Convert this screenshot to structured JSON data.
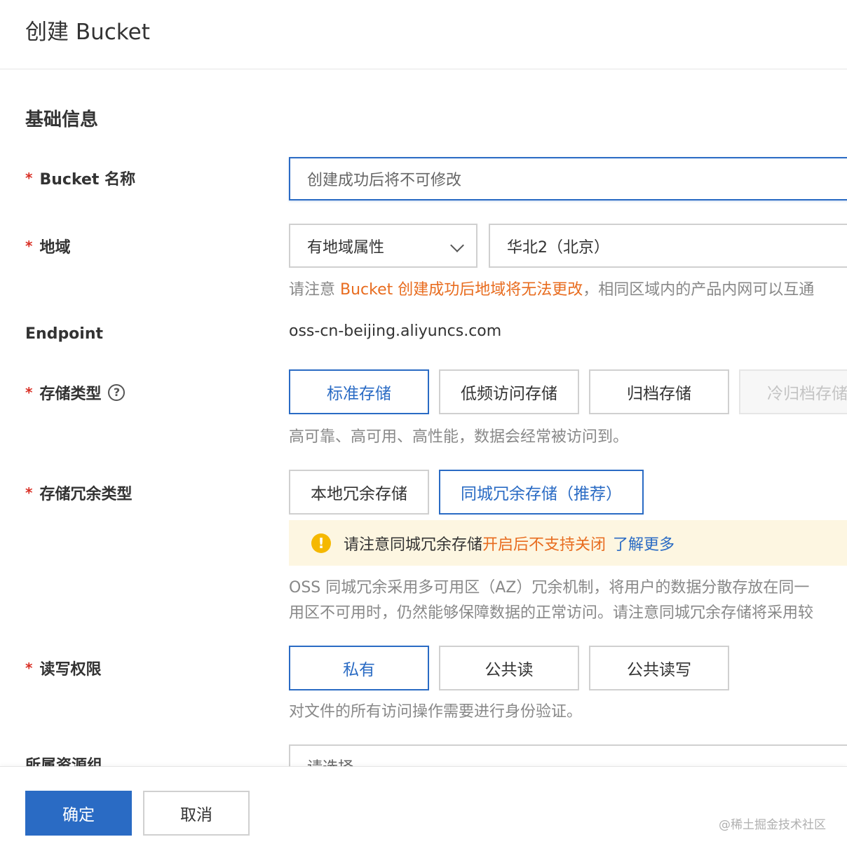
{
  "header": {
    "title": "创建 Bucket"
  },
  "section": {
    "title": "基础信息"
  },
  "fields": {
    "bucket_name": {
      "label": "Bucket 名称",
      "placeholder": "创建成功后将不可修改"
    },
    "region": {
      "label": "地域",
      "type_select": "有地域属性",
      "region_select": "华北2（北京）",
      "hint_prefix": "请注意 ",
      "hint_warning": "Bucket 创建成功后地域将无法更改",
      "hint_suffix": "，相同区域内的产品内网可以互通"
    },
    "endpoint": {
      "label": "Endpoint",
      "value": "oss-cn-beijing.aliyuncs.com"
    },
    "storage_class": {
      "label": "存储类型",
      "help_icon": "?",
      "options": [
        "标准存储",
        "低频访问存储",
        "归档存储",
        "冷归档存储"
      ],
      "selected": "标准存储",
      "hint": "高可靠、高可用、高性能，数据会经常被访问到。"
    },
    "redundancy": {
      "label": "存储冗余类型",
      "options": [
        "本地冗余存储",
        "同城冗余存储（推荐）"
      ],
      "selected": "同城冗余存储（推荐）",
      "notice_icon": "!",
      "notice_text": "请注意同城冗余存储",
      "notice_warning": "开启后不支持关闭",
      "notice_link": "了解更多",
      "desc_line1": "OSS 同城冗余采用多可用区（AZ）冗余机制，将用户的数据分散存放在同一",
      "desc_line2": "用区不可用时，仍然能够保障数据的正常访问。请注意同城冗余存储将采用较"
    },
    "acl": {
      "label": "读写权限",
      "options": [
        "私有",
        "公共读",
        "公共读写"
      ],
      "selected": "私有",
      "hint": "对文件的所有访问操作需要进行身份验证。"
    },
    "resource_group": {
      "label": "所属资源组",
      "placeholder": "请选择"
    }
  },
  "footer": {
    "confirm": "确定",
    "cancel": "取消",
    "watermark": "@稀土掘金技术社区"
  },
  "colors": {
    "primary": "#2a6bc4",
    "warning": "#e86c1f",
    "required": "#d93026",
    "notice_bg": "#fdf6e1"
  }
}
